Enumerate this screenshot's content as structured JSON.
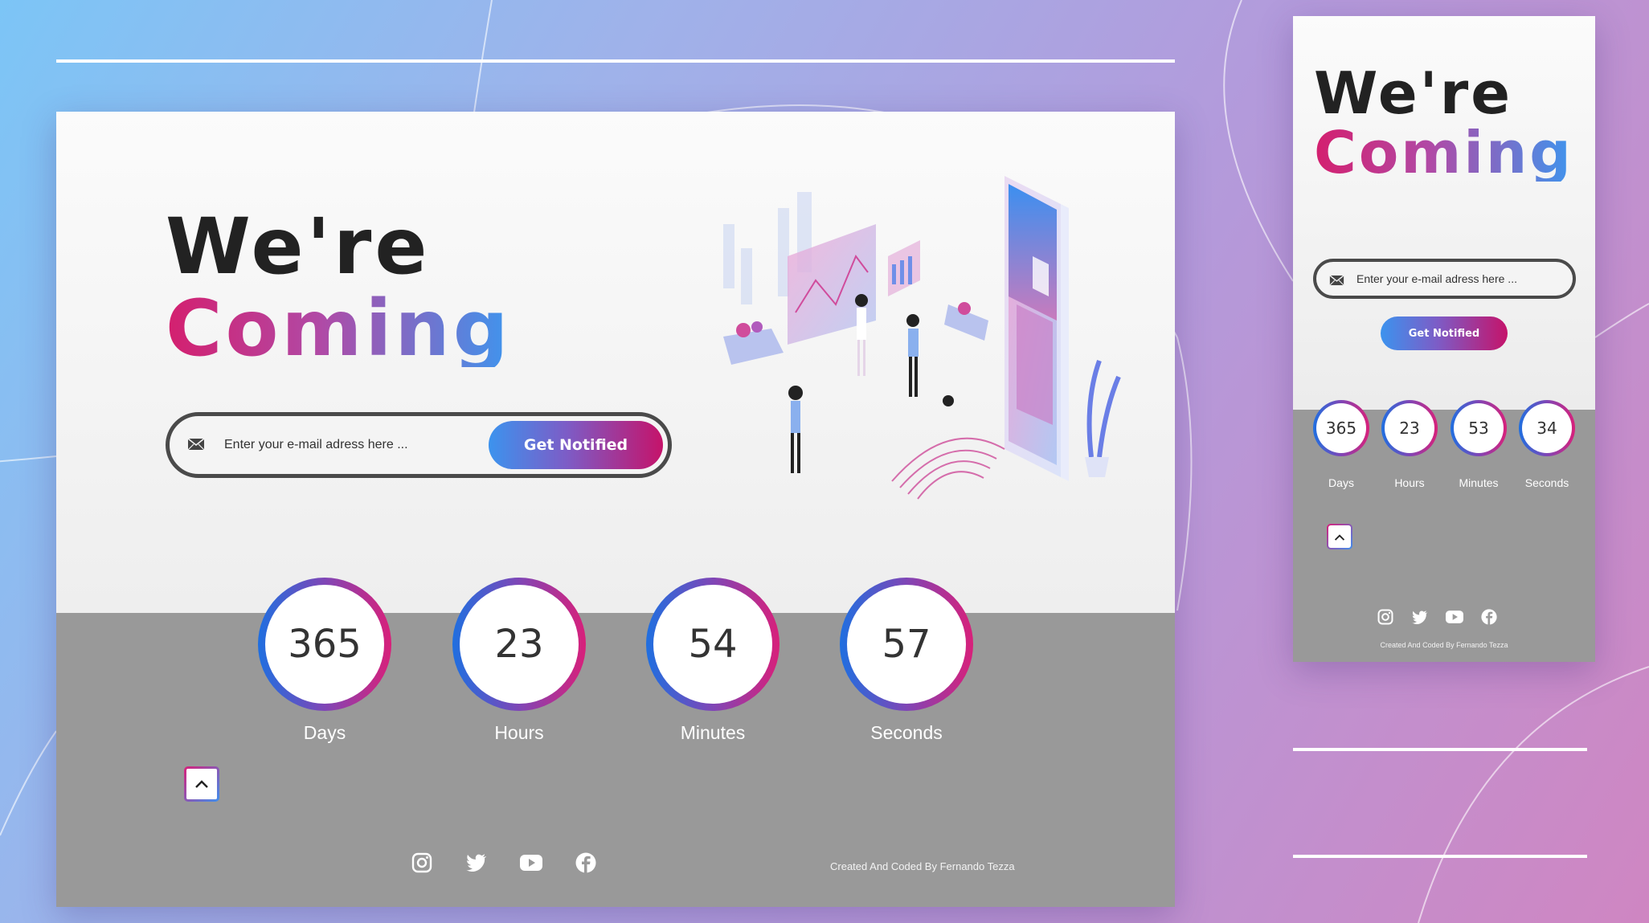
{
  "brand": {
    "gradient": [
      "#d41f6e",
      "#b04aa6",
      "#3e95ee"
    ],
    "dark_text": "#222222",
    "footer_gray": "#999999"
  },
  "hero": {
    "title_line1": "We're",
    "title_line2": "Coming"
  },
  "signup": {
    "placeholder": "Enter your e-mail adress here ...",
    "button_label": "Get Notified",
    "mail_icon": "envelope-icon"
  },
  "desktop": {
    "countdown": [
      {
        "value": "365",
        "label": "Days"
      },
      {
        "value": "23",
        "label": "Hours"
      },
      {
        "value": "54",
        "label": "Minutes"
      },
      {
        "value": "57",
        "label": "Seconds"
      }
    ]
  },
  "mobile": {
    "countdown": [
      {
        "value": "365",
        "label": "Days"
      },
      {
        "value": "23",
        "label": "Hours"
      },
      {
        "value": "53",
        "label": "Minutes"
      },
      {
        "value": "34",
        "label": "Seconds"
      }
    ]
  },
  "scroll_top": {
    "icon": "chevron-up-icon"
  },
  "social": [
    "instagram-icon",
    "twitter-icon",
    "youtube-icon",
    "facebook-icon"
  ],
  "footer": {
    "credit": "Created And Coded By Fernando Tezza"
  }
}
